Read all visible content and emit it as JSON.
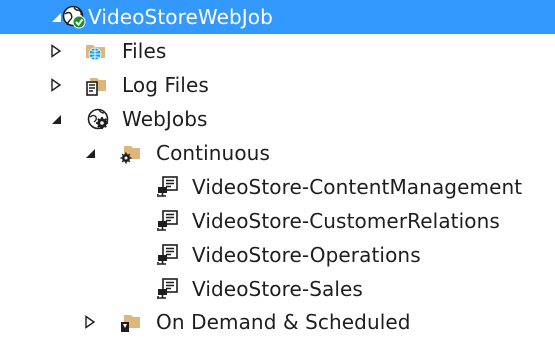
{
  "tree": {
    "root": {
      "label": "VideoStoreWebJob",
      "icon": "website-globe-check-icon",
      "expanded": true,
      "selected": true
    },
    "files": {
      "label": "Files",
      "icon": "globe-folder-icon",
      "expanded": false
    },
    "log_files": {
      "label": "Log Files",
      "icon": "log-files-folder-icon",
      "expanded": false
    },
    "webjobs": {
      "label": "WebJobs",
      "icon": "webjobs-gear-icon",
      "expanded": true
    },
    "continuous": {
      "label": "Continuous",
      "icon": "continuous-folder-icon",
      "expanded": true
    },
    "jobs": [
      {
        "label": "VideoStore-ContentManagement",
        "icon": "webjob-icon"
      },
      {
        "label": "VideoStore-CustomerRelations",
        "icon": "webjob-icon"
      },
      {
        "label": "VideoStore-Operations",
        "icon": "webjob-icon"
      },
      {
        "label": "VideoStore-Sales",
        "icon": "webjob-icon"
      }
    ],
    "on_demand": {
      "label": "On Demand & Scheduled",
      "icon": "scheduled-folder-icon",
      "expanded": false
    }
  },
  "colors": {
    "selection": "#3399ff",
    "folder": "#dcb67a",
    "globe": "#1ba1e2",
    "text": "#1e1e1e"
  }
}
